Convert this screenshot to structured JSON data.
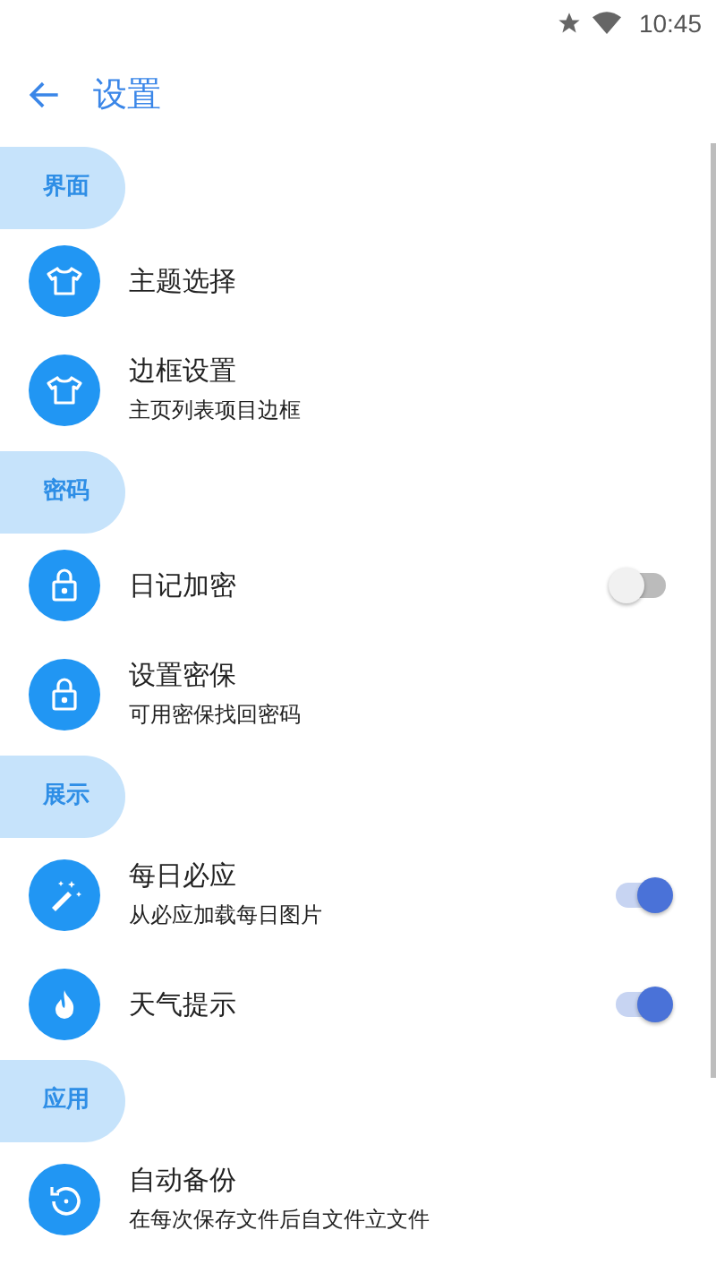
{
  "status_bar": {
    "time": "10:45"
  },
  "toolbar": {
    "title": "设置"
  },
  "sections": [
    {
      "title": "界面",
      "items": [
        {
          "kind": "plain",
          "title": "主题选择"
        },
        {
          "kind": "plain",
          "title": "边框设置",
          "subtitle": "主页列表项目边框"
        }
      ]
    },
    {
      "title": "密码",
      "items": [
        {
          "kind": "toggle",
          "title": "日记加密",
          "on": false
        },
        {
          "kind": "plain",
          "title": "设置密保",
          "subtitle": "可用密保找回密码"
        }
      ]
    },
    {
      "title": "展示",
      "items": [
        {
          "kind": "toggle",
          "title": "每日必应",
          "subtitle": "从必应加载每日图片",
          "on": true
        },
        {
          "kind": "toggle",
          "title": "天气提示",
          "on": true
        }
      ]
    },
    {
      "title": "应用",
      "items": [
        {
          "kind": "plain",
          "title": "自动备份",
          "subtitle": "在每次保存文件后自文件立文件"
        }
      ]
    }
  ]
}
